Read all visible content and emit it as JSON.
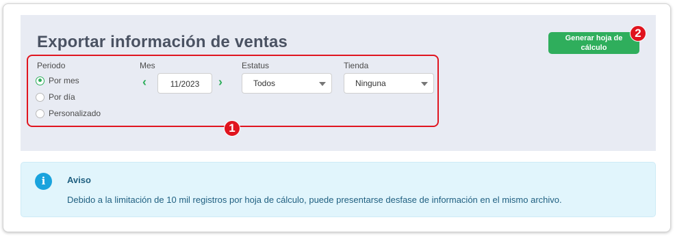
{
  "export_panel": {
    "title": "Exportar información de ventas",
    "generate_button": "Generar hoja de cálculo",
    "badge_button": "2",
    "badge_filters": "1",
    "periodo": {
      "label": "Periodo",
      "options": [
        "Por mes",
        "Por día",
        "Personalizado"
      ],
      "selected": "Por mes"
    },
    "mes": {
      "label": "Mes",
      "value": "11/2023"
    },
    "estatus": {
      "label": "Estatus",
      "value": "Todos"
    },
    "tienda": {
      "label": "Tienda",
      "value": "Ninguna"
    }
  },
  "notice": {
    "icon": "info-icon",
    "title": "Aviso",
    "text": "Debido a la limitación de 10 mil registros por hoja de cálculo, puede presentarse desfase de información en el mismo archivo."
  },
  "colors": {
    "accent_green": "#2fae5c",
    "highlight_red": "#e0141e",
    "info_blue": "#1aa3dd"
  }
}
